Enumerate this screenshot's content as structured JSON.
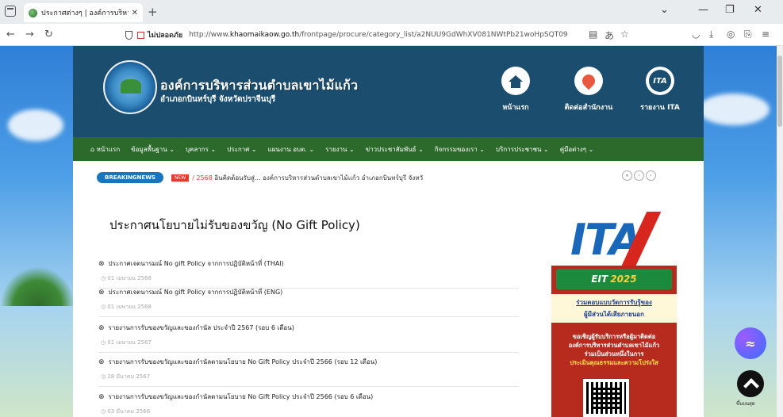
{
  "browser": {
    "tab_title": "ประกาศต่างๆ | องค์การบริหารส่วน X",
    "new_tab": "+",
    "insecure_label": "ไม่ปลอดภัย",
    "url_prefix": "http://www.",
    "url_host": "khaomaikaow.go.th",
    "url_path": "/frontpage/procure/category_list/a2NUU9GdWhXV081NWtPb21woHpSQT09",
    "icons": [
      "tab-list-icon",
      "back-icon",
      "forward-icon",
      "reload-icon",
      "shield-icon",
      "lock-icon",
      "reader-icon",
      "translate-icon",
      "star-icon",
      "pocket-icon",
      "download-icon",
      "extensions-icon",
      "account-icon",
      "menu-icon",
      "minimize-icon",
      "maximize-icon",
      "close-icon"
    ]
  },
  "header": {
    "org_name": "องค์การบริหารส่วนตำบลเขาไม้แก้ว",
    "org_sub": "อำเภอกบินทร์บุรี  จังหวัดปราจีนบุรี",
    "quick_links": [
      {
        "label": "หน้าแรก",
        "icon": "home-icon"
      },
      {
        "label": "ติดต่อสำนักงาน",
        "icon": "location-pin-icon"
      },
      {
        "label": "รายงาน ITA",
        "icon": "ita-icon",
        "text": "ITA"
      }
    ]
  },
  "menu": {
    "items": [
      "หน้าแรก",
      "ข้อมูลพื้นฐาน ⌄",
      "บุคลากร ⌄",
      "ประกาศ ⌄",
      "แผนงาน อบต. ⌄",
      "รายงาน ⌄",
      "ข่าวประชาสัมพันธ์ ⌄",
      "กิจกรรมของเรา ⌄",
      "บริการประชาชน ⌄",
      "คู่มือต่างๆ ⌄"
    ]
  },
  "breaking": {
    "tag": "BREAKINGNEWS",
    "new_badge": "NEW",
    "year": "/ 2568",
    "text": "อินคิดต้อนรับสู่... องค์การบริหารส่วนตำบลเขาไม้แก้ว อำเภอกบินทร์บุรี จังหวั",
    "controls": [
      "⏸",
      "‹",
      "›"
    ]
  },
  "main": {
    "title": "ประกาศนโยบายไม่รับของขวัญ (No Gift Policy)",
    "posts": [
      {
        "title": "ประกาศเจตนารมณ์ No gift Policy จากการปฏิบัติหน้าที่ (THAI)",
        "date": "01 เมษายน 2568"
      },
      {
        "title": "ประกาศเจตนารมณ์ No gift Policy จากการปฏิบัติหน้าที่ (ENG)",
        "date": "01 เมษายน 2568"
      },
      {
        "title": "รายงานการรับของขวัญและของกำนัล ประจำปี 2567 (รอบ 6 เดือน)",
        "date": "01 เมษายน 2567"
      },
      {
        "title": "รายงานการรับของขวัญและของกำนัลตามนโยบาย No Gift Policy ประจำปี 2566 (รอบ 12 เดือน)",
        "date": "28 มีนาคม 2567"
      },
      {
        "title": "รายงานการรับของขวัญและของกำนัลตามนโยบาย No Gift Policy ประจำปี 2566 (รอบ 6 เดือน)",
        "date": "03 มีนาคม 2566"
      }
    ]
  },
  "sidebar": {
    "ita_text": "ITA",
    "eit_label": "EIT",
    "eit_year": "2025",
    "line1": "ร่วมตอบแบบวัดการรับรู้ของ",
    "line2": "ผู้มีส่วนได้เสียภายนอก",
    "line3": "ขอเชิญผู้รับบริการหรือผู้มาติดต่อ",
    "line4": "องค์การบริหารส่วนตำบลเขาไม้แก้ว",
    "line5": "ร่วมเป็นส่วนหนึ่งในการ",
    "line6": "ประเมินคุณธรรมและความโปร่งใส"
  },
  "floating": {
    "back_to_top_label": "ขึ้นบนสุด"
  },
  "colors": {
    "header_bg": "#1b4d6e",
    "menu_bg": "#2b6a2b",
    "breaking_tag": "#1b75bb",
    "new_badge": "#e03c31",
    "side_panel": "#b72a1e"
  }
}
